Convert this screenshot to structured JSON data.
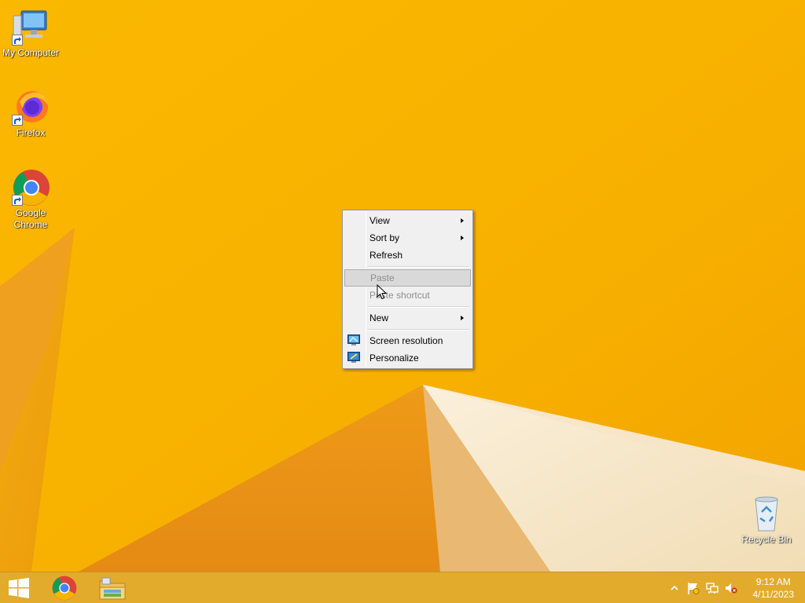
{
  "desktop": {
    "icons": [
      {
        "label": "My Computer",
        "icon": "computer-icon"
      },
      {
        "label": "Firefox",
        "icon": "firefox-icon"
      },
      {
        "label": "Google Chrome",
        "icon": "chrome-icon"
      },
      {
        "label": "Recycle Bin",
        "icon": "recycle-bin-icon"
      }
    ]
  },
  "context_menu": {
    "items": [
      {
        "label": "View",
        "submenu": true,
        "enabled": true
      },
      {
        "label": "Sort by",
        "submenu": true,
        "enabled": true
      },
      {
        "label": "Refresh",
        "submenu": false,
        "enabled": true
      },
      {
        "label": "Paste",
        "submenu": false,
        "enabled": false,
        "highlighted": true
      },
      {
        "label": "Paste shortcut",
        "submenu": false,
        "enabled": false
      },
      {
        "label": "New",
        "submenu": true,
        "enabled": true
      },
      {
        "label": "Screen resolution",
        "submenu": false,
        "enabled": true,
        "icon": "screen-resolution-icon"
      },
      {
        "label": "Personalize",
        "submenu": false,
        "enabled": true,
        "icon": "personalize-icon"
      }
    ]
  },
  "taskbar": {
    "pinned": [
      "start-button",
      "chrome-taskbar-icon",
      "file-explorer-taskbar-icon"
    ],
    "tray": [
      "show-hidden-icons-chevron",
      "action-center-flag-icon",
      "network-icon",
      "volume-muted-icon"
    ],
    "clock": {
      "time": "9:12 AM",
      "date": "4/11/2023"
    }
  },
  "colors": {
    "wallpaper": "#f8b400",
    "taskbar": "#e3ab2c",
    "menu_bg": "#f0f0f0"
  }
}
